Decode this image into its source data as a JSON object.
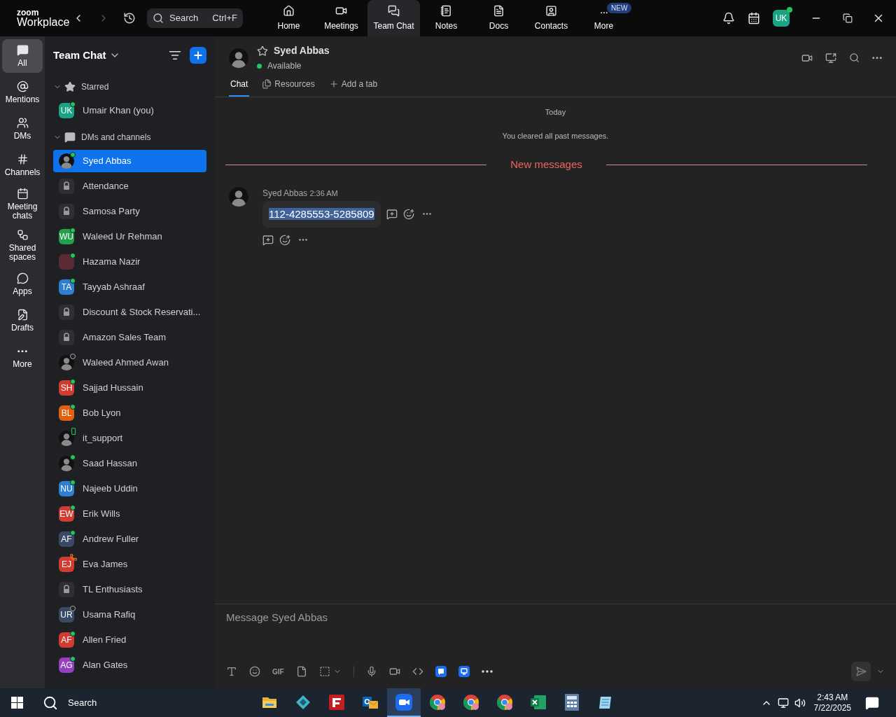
{
  "app": {
    "logo_top": "zoom",
    "logo_bottom": "Workplace",
    "search": {
      "placeholder": "Search",
      "shortcut": "Ctrl+F"
    },
    "user_initials": "UK",
    "user_online": true
  },
  "nav": [
    {
      "label": "Home",
      "kind": "home",
      "selected": false
    },
    {
      "label": "Meetings",
      "kind": "meetings",
      "selected": false
    },
    {
      "label": "Team Chat",
      "kind": "chat",
      "selected": true
    },
    {
      "label": "Notes",
      "kind": "notes",
      "selected": false
    },
    {
      "label": "Docs",
      "kind": "docs",
      "selected": false
    },
    {
      "label": "Contacts",
      "kind": "contacts",
      "selected": false
    },
    {
      "label": "More",
      "kind": "more",
      "selected": false,
      "badge": "NEW"
    }
  ],
  "rail": [
    {
      "label": "All",
      "kind": "all",
      "selected": true
    },
    {
      "label": "Mentions",
      "kind": "mentions",
      "selected": false
    },
    {
      "label": "DMs",
      "kind": "dms",
      "selected": false
    },
    {
      "label": "Channels",
      "kind": "channels",
      "selected": false
    },
    {
      "label": "Meeting chats",
      "kind": "meetings",
      "selected": false
    },
    {
      "label": "Shared spaces",
      "kind": "shared",
      "selected": false
    },
    {
      "label": "Apps",
      "kind": "apps",
      "selected": false
    },
    {
      "label": "Drafts",
      "kind": "drafts",
      "selected": false
    },
    {
      "label": "More",
      "kind": "more",
      "selected": false
    }
  ],
  "sidebar": {
    "title": "Team Chat",
    "sections": [
      {
        "title": "Starred",
        "kind": "starred",
        "expanded": true,
        "items": [
          {
            "name": "Umair Khan (you)",
            "kind": "initials",
            "initials": "UK",
            "color": "#1aa384",
            "status": {
              "kind": "online"
            },
            "selected": false
          }
        ]
      },
      {
        "title": "DMs and channels",
        "kind": "dms",
        "expanded": true,
        "items": [
          {
            "name": "Syed Abbas",
            "kind": "photo",
            "status": {
              "kind": "online"
            },
            "selected": true
          },
          {
            "name": "Attendance",
            "kind": "lock",
            "selected": false
          },
          {
            "name": "Samosa Party",
            "kind": "lock",
            "selected": false
          },
          {
            "name": "Waleed Ur Rehman",
            "kind": "initials",
            "initials": "WU",
            "color": "#22a04b",
            "status": {
              "kind": "online"
            },
            "selected": false
          },
          {
            "name": "Hazama Nazir",
            "kind": "initials",
            "color": "#5a2a35",
            "status": {
              "kind": "online"
            },
            "selected": false
          },
          {
            "name": "Tayyab Ashraaf",
            "kind": "initials",
            "initials": "TA",
            "color": "#2f7fd0",
            "status": {
              "kind": "online"
            },
            "selected": false
          },
          {
            "name": "Discount & Stock Reservati...",
            "kind": "lock",
            "selected": false
          },
          {
            "name": "Amazon Sales Team",
            "kind": "lock",
            "selected": false
          },
          {
            "name": "Waleed Ahmed Awan",
            "kind": "photo",
            "status": {
              "kind": "offline"
            },
            "selected": false
          },
          {
            "name": "Sajjad Hussain",
            "kind": "initials",
            "initials": "SH",
            "color": "#d23b32",
            "status": {
              "kind": "online"
            },
            "selected": false
          },
          {
            "name": "Bob Lyon",
            "kind": "initials",
            "initials": "BL",
            "color": "#e0600f",
            "status": {
              "kind": "online"
            },
            "selected": false
          },
          {
            "name": "it_support",
            "kind": "photo",
            "status": {
              "kind": "mobile"
            },
            "selected": false
          },
          {
            "name": "Saad Hassan",
            "kind": "photo",
            "status": {
              "kind": "online"
            },
            "selected": false
          },
          {
            "name": "Najeeb Uddin",
            "kind": "initials",
            "initials": "NU",
            "color": "#2f7fd0",
            "status": {
              "kind": "online"
            },
            "selected": false
          },
          {
            "name": "Erik Wills",
            "kind": "initials",
            "initials": "EW",
            "color": "#d23b32",
            "status": {
              "kind": "online"
            },
            "selected": false
          },
          {
            "name": "Andrew Fuller",
            "kind": "initials",
            "initials": "AF",
            "color": "#3a4a66",
            "status": {
              "kind": "online"
            },
            "selected": false
          },
          {
            "name": "Eva James",
            "kind": "initials",
            "initials": "EJ",
            "color": "#d23b32",
            "status": {
              "kind": "call"
            },
            "selected": false
          },
          {
            "name": "TL Enthusiasts",
            "kind": "lock",
            "selected": false
          },
          {
            "name": "Usama Rafiq",
            "kind": "initials",
            "initials": "UR",
            "color": "#3a4a66",
            "status": {
              "kind": "offline"
            },
            "selected": false
          },
          {
            "name": "Allen Fried",
            "kind": "initials",
            "initials": "AF",
            "color": "#d23b32",
            "status": {
              "kind": "online"
            },
            "selected": false
          },
          {
            "name": "Alan Gates",
            "kind": "initials",
            "initials": "AG",
            "color": "#9440c0",
            "status": {
              "kind": "online"
            },
            "selected": false
          }
        ]
      }
    ]
  },
  "chat": {
    "name": "Syed Abbas",
    "presence": "Available",
    "online": true,
    "starred": false,
    "tabs": [
      {
        "label": "Chat",
        "kind": "chat",
        "selected": true
      },
      {
        "label": "Resources",
        "kind": "resources",
        "selected": false
      },
      {
        "label": "Add a tab",
        "kind": "add",
        "selected": false
      }
    ],
    "day": "Today",
    "notice": "You cleared all past messages.",
    "divider": "New messages",
    "messages": [
      {
        "sender": "Syed Abbas",
        "time": "2:36 AM",
        "text": "112-4285553-5285809",
        "highlighted": true
      }
    ],
    "composer": {
      "placeholder": "Message Syed Abbas",
      "gif": "GIF"
    }
  },
  "taskbar": {
    "search": "Search",
    "time": "2:43 AM",
    "date": "7/22/2025",
    "apps": [
      {
        "kind": "folder",
        "active": false
      },
      {
        "kind": "diamond",
        "active": false
      },
      {
        "kind": "ftp",
        "active": false
      },
      {
        "kind": "mail",
        "active": false
      },
      {
        "kind": "video",
        "active": true
      },
      {
        "kind": "browser",
        "active": false
      },
      {
        "kind": "browser",
        "active": false
      },
      {
        "kind": "browser",
        "active": false
      },
      {
        "kind": "sheet",
        "active": false
      },
      {
        "kind": "calculator",
        "active": false
      },
      {
        "kind": "notepad",
        "active": false
      }
    ]
  }
}
